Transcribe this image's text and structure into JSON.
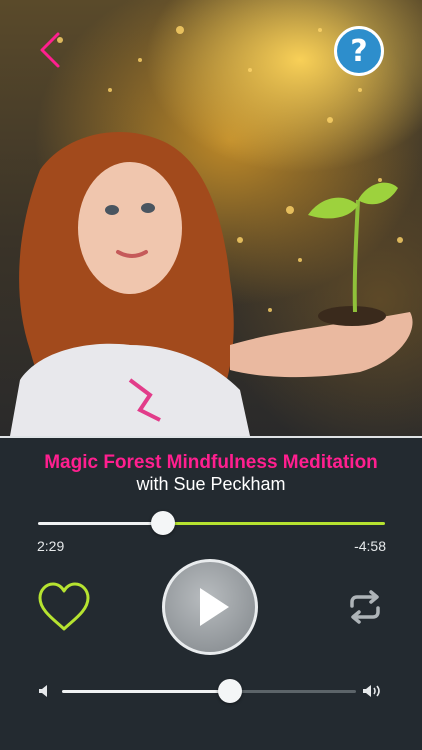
{
  "header": {
    "back_icon": "chevron-left-icon",
    "help_label": "?"
  },
  "track": {
    "title": "Magic Forest Mindfulness Meditation",
    "artist": "with Sue Peckham"
  },
  "progress": {
    "elapsed": "2:29",
    "remaining": "-4:58",
    "fraction": 0.36
  },
  "controls": {
    "favorite_icon": "heart-outline-icon",
    "play_icon": "play-icon",
    "repeat_icon": "repeat-icon"
  },
  "volume": {
    "level": 0.57,
    "min_icon": "volume-low-icon",
    "max_icon": "volume-high-icon"
  },
  "colors": {
    "accent_pink": "#ff1f8f",
    "accent_lime": "#b6e330",
    "help_blue": "#2d8ecc",
    "background": "#232a30"
  }
}
